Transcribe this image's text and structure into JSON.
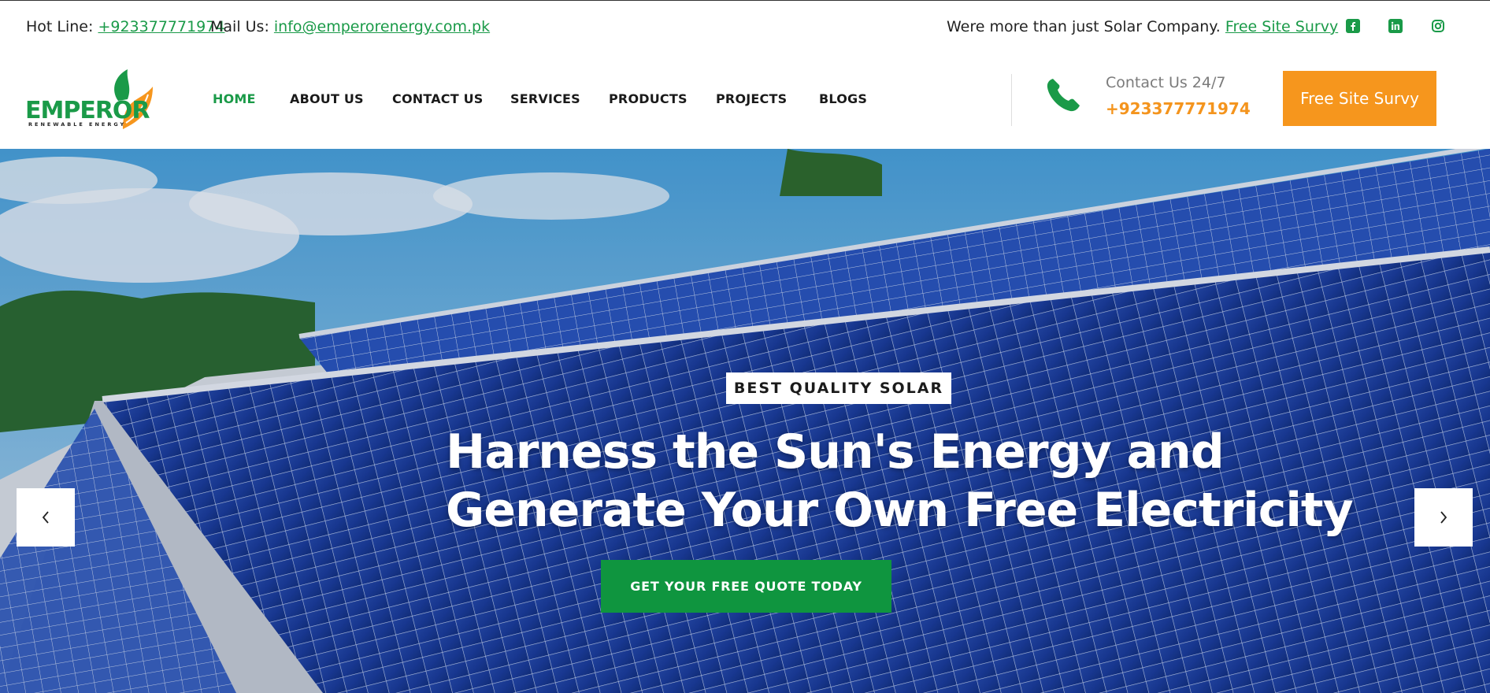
{
  "topbar": {
    "hotline_label": "Hot Line:",
    "hotline_number": "+923377771974",
    "mail_label": "Mail Us:",
    "mail_address": "info@emperorenergy.com.pk",
    "tagline": "Were more than just Solar Company.",
    "tagline_link": "Free Site Survy",
    "social": [
      "facebook-icon",
      "linkedin-icon",
      "instagram-icon"
    ]
  },
  "header": {
    "logo_text": "EMPEROR",
    "logo_sub": "RENEWABLE ENERGY",
    "nav": [
      "HOME",
      "ABOUT US",
      "CONTACT US",
      "SERVICES",
      "PRODUCTS",
      "PROJECTS",
      "BLOGS"
    ],
    "contact_label": "Contact Us 24/7",
    "contact_number": "+923377771974",
    "cta": "Free Site Survy"
  },
  "hero": {
    "badge": "BEST QUALITY SOLAR",
    "headline_line1": "Harness the Sun's Energy and",
    "headline_line2": "Generate Your Own Free Electricity",
    "button": "GET YOUR FREE QUOTE TODAY"
  },
  "colors": {
    "brand_green": "#1a9a48",
    "brand_orange": "#f6961d"
  }
}
